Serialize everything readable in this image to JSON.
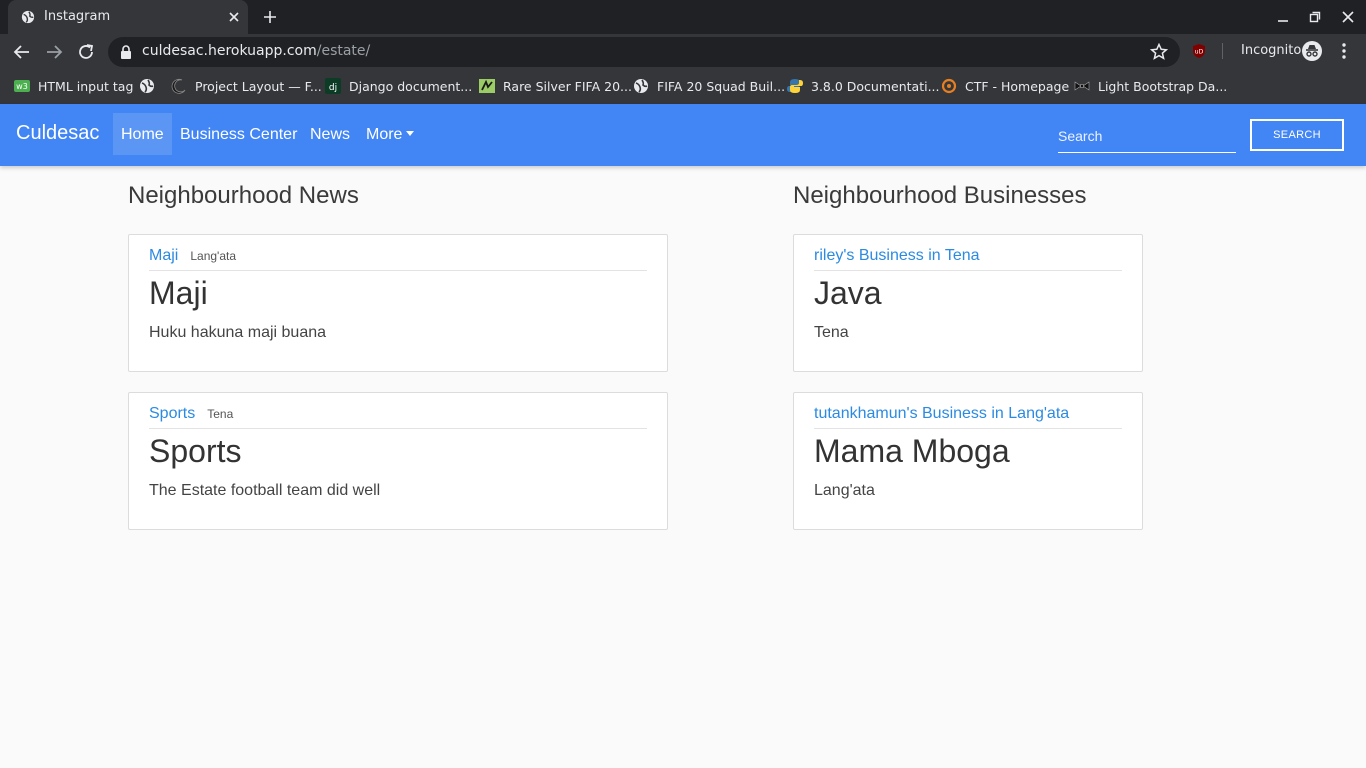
{
  "browser": {
    "tab_title": "Instagram",
    "url_host": "culdesac.herokuapp.com",
    "url_path": "/estate/",
    "incognito_label": "Incognito",
    "bookmarks": [
      {
        "label": "HTML input tag",
        "icon": "w3schools-icon"
      },
      {
        "label": "",
        "icon": "globe-icon"
      },
      {
        "label": "Project Layout — F...",
        "icon": "moon-icon"
      },
      {
        "label": "Django document...",
        "icon": "django-icon"
      },
      {
        "label": "Rare Silver FIFA 20...",
        "icon": "futwiz-icon"
      },
      {
        "label": "FIFA 20 Squad Buil...",
        "icon": "globe-icon"
      },
      {
        "label": "3.8.0 Documentati...",
        "icon": "python-icon"
      },
      {
        "label": "CTF - Homepage",
        "icon": "ctf-icon"
      },
      {
        "label": "Light Bootstrap Da...",
        "icon": "bowtie-icon"
      }
    ]
  },
  "navbar": {
    "brand": "Culdesac",
    "links": [
      "Home",
      "Business Center",
      "News",
      "More"
    ],
    "active": "Home",
    "search_placeholder": "Search",
    "search_button": "Search",
    "color": "#4285f4"
  },
  "news": {
    "title": "Neighbourhood News",
    "items": [
      {
        "link": "Maji",
        "tag": "Lang'ata",
        "heading": "Maji",
        "text": "Huku hakuna maji buana"
      },
      {
        "link": "Sports",
        "tag": "Tena",
        "heading": "Sports",
        "text": "The Estate football team did well"
      }
    ]
  },
  "businesses": {
    "title": "Neighbourhood Businesses",
    "items": [
      {
        "link": "riley's Business in Tena",
        "heading": "Java",
        "text": "Tena"
      },
      {
        "link": "tutankhamun's Business in Lang'ata",
        "heading": "Mama Mboga",
        "text": "Lang'ata"
      }
    ]
  }
}
